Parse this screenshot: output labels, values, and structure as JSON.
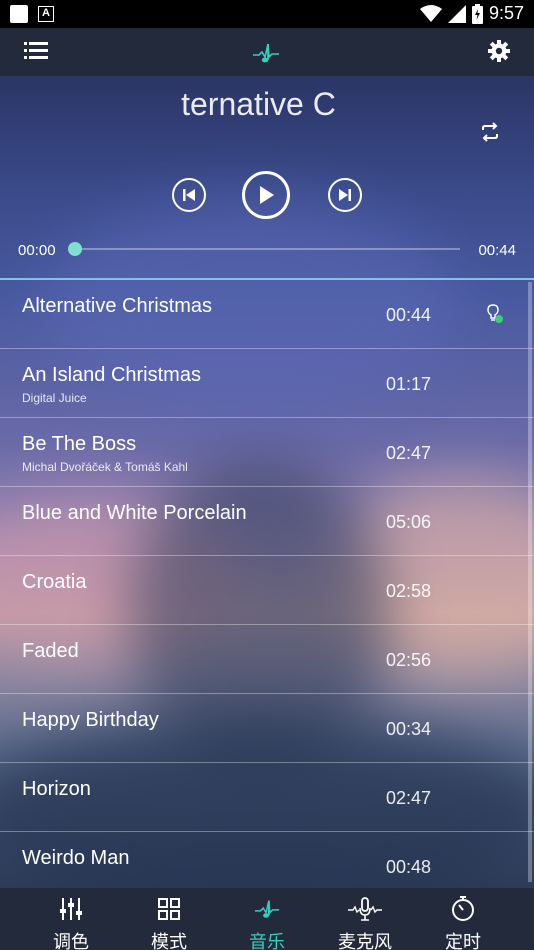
{
  "status_bar": {
    "time": "9:57"
  },
  "player": {
    "title_fragment": "lternative C",
    "current_time": "00:00",
    "total_time": "00:44",
    "progress": 0.0
  },
  "playlist": [
    {
      "title": "Alternative Christmas",
      "artist": "",
      "duration": "00:44",
      "playing": true
    },
    {
      "title": "An Island Christmas",
      "artist": "Digital Juice",
      "duration": "01:17"
    },
    {
      "title": "Be The Boss",
      "artist": "Michal Dvořáček & Tomáš Kahl",
      "duration": "02:47"
    },
    {
      "title": "Blue and White Porcelain",
      "artist": "",
      "duration": "05:06"
    },
    {
      "title": "Croatia",
      "artist": "",
      "duration": "02:58"
    },
    {
      "title": "Faded",
      "artist": "",
      "duration": "02:56"
    },
    {
      "title": "Happy Birthday",
      "artist": "",
      "duration": "00:34"
    },
    {
      "title": "Horizon",
      "artist": "",
      "duration": "02:47"
    },
    {
      "title": "Weirdo Man",
      "artist": "",
      "duration": "00:48"
    }
  ],
  "tabs": [
    {
      "label": "调色",
      "icon": "equalizer-icon"
    },
    {
      "label": "模式",
      "icon": "grid-icon"
    },
    {
      "label": "音乐",
      "icon": "music-note-icon",
      "active": true
    },
    {
      "label": "麦克风",
      "icon": "microphone-icon"
    },
    {
      "label": "定时",
      "icon": "timer-icon"
    }
  ],
  "colors": {
    "accent": "#35d0c0",
    "bar": "#222a3c",
    "progress": "#7fe0d2"
  }
}
